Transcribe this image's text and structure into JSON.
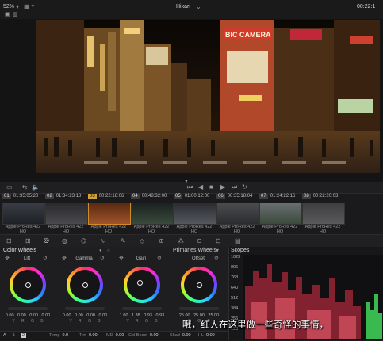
{
  "topbar": {
    "zoom": "52%",
    "clip_name": "Hikari",
    "timecode": "00:22:1"
  },
  "transport": {
    "marker_timecode": ""
  },
  "timeline": {
    "clips": [
      {
        "num": "01",
        "tc": "01:35:05:20",
        "codec": "",
        "active": false
      },
      {
        "num": "02",
        "tc": "01:34:23:18",
        "codec": "Apple ProRes 422 HQ",
        "active": false
      },
      {
        "num": "03",
        "tc": "00:22:18:06",
        "codec": "Apple ProRes 422 HQ",
        "active": true
      },
      {
        "num": "04",
        "tc": "00:48:32:00",
        "codec": "",
        "active": false
      },
      {
        "num": "05",
        "tc": "01:00:12:00",
        "codec": "Apple ProRes 422 HQ",
        "active": false
      },
      {
        "num": "06",
        "tc": "00:35:18:04",
        "codec": "Apple ProRes 422 HQ",
        "active": false
      },
      {
        "num": "07",
        "tc": "01:24:22:16",
        "codec": "Apple ProRes 422 HQ",
        "active": false
      },
      {
        "num": "08",
        "tc": "00:22:20:03",
        "codec": "Apple ProRes 422 HQ",
        "active": false
      }
    ],
    "first_codec": "Apple ProRes 422 HQ",
    "fourth_codec": "Apple ProRes 422 HQ"
  },
  "color_wheels": {
    "title": "Color Wheels",
    "primaries_label": "Primaries Wheels",
    "wheels": [
      {
        "name": "Lift",
        "values": "0.00  0.00  0.00  0.00",
        "channels": "Y  R  G  B"
      },
      {
        "name": "Gamma",
        "values": "0.00  0.00  0.00  0.00",
        "channels": "Y  R  G  B"
      },
      {
        "name": "Gain",
        "values": "1.00  1.38  0.93  0.93",
        "channels": "Y  R  G  B"
      },
      {
        "name": "Offset",
        "values": "25.00  25.00  25.00",
        "channels": "R  G  B"
      }
    ]
  },
  "status": {
    "a_label": "A",
    "page1": "1",
    "page2": "2",
    "temp_label": "Temp",
    "temp_val": "0.0",
    "tint_label": "Tint",
    "tint_val": "0.00",
    "md_label": "MD",
    "md_val": "0.00",
    "colboost_label": "Col Boost",
    "colboost_val": "0.00",
    "shad_label": "Shad",
    "shad_val": "0.00",
    "hilight_label": "HL",
    "hilight_val": "0.00"
  },
  "scopes": {
    "title": "Scopes",
    "axis": [
      "1023",
      "896",
      "768",
      "640",
      "512",
      "384",
      "256",
      "128"
    ]
  },
  "subtitle": "哦，红人在这里做一些奇怪的事情，",
  "colors": {
    "accent": "#d4a23a",
    "scope_red": "#e0304a",
    "scope_green": "#3fd85a"
  }
}
